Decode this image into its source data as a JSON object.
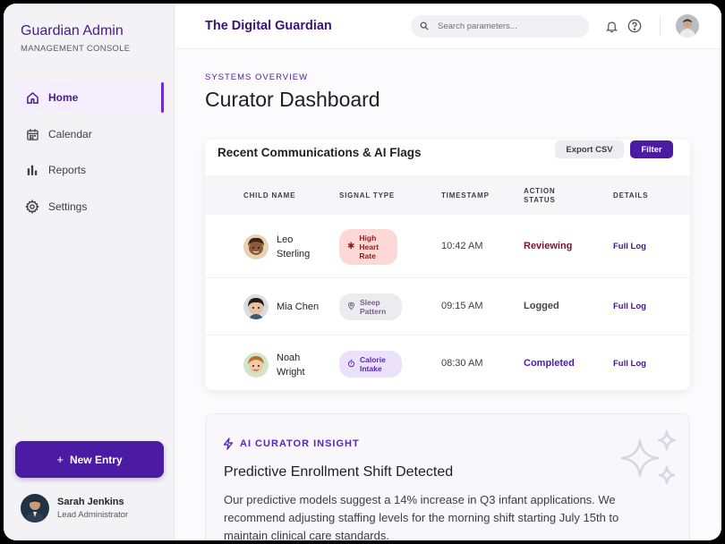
{
  "brand": {
    "title": "Guardian Admin",
    "subtitle": "MANAGEMENT CONSOLE"
  },
  "sidebar": {
    "items": [
      {
        "label": "Home",
        "icon": "home-icon",
        "active": true
      },
      {
        "label": "Calendar",
        "icon": "calendar-icon",
        "active": false
      },
      {
        "label": "Reports",
        "icon": "bar-chart-icon",
        "active": false
      },
      {
        "label": "Settings",
        "icon": "gear-icon",
        "active": false
      }
    ],
    "new_entry_label": "New Entry",
    "user": {
      "name": "Sarah Jenkins",
      "role": "Lead Administrator"
    }
  },
  "topbar": {
    "app_title": "The Digital Guardian",
    "search_placeholder": "Search parameters..."
  },
  "header": {
    "eyebrow": "SYSTEMS OVERVIEW",
    "title": "Curator Dashboard"
  },
  "communications": {
    "title": "Recent Communications & AI Flags",
    "export_label": "Export CSV",
    "filter_label": "Filter",
    "columns": [
      "CHILD NAME",
      "SIGNAL TYPE",
      "TIMESTAMP",
      "ACTION STATUS",
      "DETAILS"
    ],
    "rows": [
      {
        "child": "Leo Sterling",
        "signal": "High Heart Rate",
        "signal_kind": "high",
        "timestamp": "10:42 AM",
        "status": "Reviewing",
        "status_color": "#7a1030",
        "details": "Full Log"
      },
      {
        "child": "Mia Chen",
        "signal": "Sleep Pattern",
        "signal_kind": "sleep",
        "timestamp": "09:15 AM",
        "status": "Logged",
        "status_color": "#45454f",
        "details": "Full Log"
      },
      {
        "child": "Noah Wright",
        "signal": "Calorie Intake",
        "signal_kind": "calorie",
        "timestamp": "08:30 AM",
        "status": "Completed",
        "status_color": "#4b1ba3",
        "details": "Full Log"
      }
    ]
  },
  "insight": {
    "tag": "AI CURATOR INSIGHT",
    "title": "Predictive Enrollment Shift Detected",
    "body": "Our predictive models suggest a 14% increase in Q3 infant applications. We recommend adjusting staffing levels for the morning shift starting July 15th to maintain clinical care standards."
  },
  "colors": {
    "accent": "#4b1ba3",
    "brand_text": "#3a1278",
    "high_pill": "#fcd9d6",
    "calorie_pill": "#ebe1fb"
  }
}
